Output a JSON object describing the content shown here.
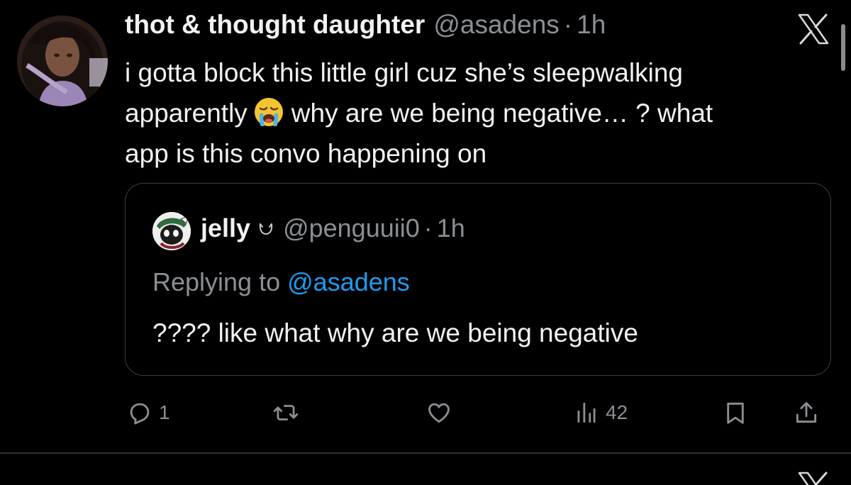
{
  "tweet": {
    "display_name": "thot & thought daughter",
    "handle": "@asadens",
    "separator": "·",
    "time": "1h",
    "text_lines": [
      "i gotta block this little girl cuz she’s sleepwalking",
      "apparently",
      "why are we being negative… ? what",
      "app is this convo happening on"
    ],
    "emoji": "loudly-crying-face"
  },
  "quote": {
    "display_name": "jelly",
    "badge_icon": "cat-face-icon",
    "handle": "@penguuii0",
    "separator": "·",
    "time": "1h",
    "replying_prefix": "Replying to",
    "replying_mention": "@asadens",
    "text": "???? like what why are we being negative"
  },
  "actions": {
    "reply_count": "1",
    "views_count": "42"
  },
  "colors": {
    "background": "#000000",
    "text": "#e7e9ea",
    "secondary": "#8b8f94",
    "accent": "#1d9bf0",
    "border": "#3a3d41"
  }
}
